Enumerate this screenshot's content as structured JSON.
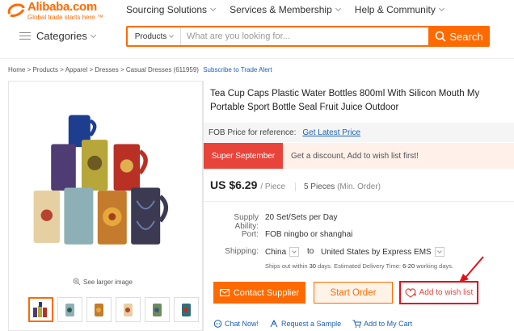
{
  "logo": {
    "brand": "Alibaba.com",
    "tagline": "Global trade starts here.™"
  },
  "topnav": [
    {
      "label": "Sourcing Solutions"
    },
    {
      "label": "Services & Membership"
    },
    {
      "label": "Help & Community"
    }
  ],
  "categories_label": "Categories",
  "search": {
    "category": "Products",
    "placeholder": "What are you looking for...",
    "button": "Search"
  },
  "breadcrumb": {
    "path": "Home > Products > Apparel > Dresses > Casual Dresses (611959)",
    "alert": "Subscribe to Trade Alert"
  },
  "gallery": {
    "see_larger": "See larger image"
  },
  "product": {
    "title": "Tea Cup Caps Plastic Water Bottles 800ml With Silicon Mouth My Portable Sport Bottle Seal Fruit Juice Outdoor",
    "fob_label": "FOB Price for reference:",
    "fob_link": "Get Latest Price",
    "promo_tag": "Super September",
    "promo_text": "Get a discount, Add to wish list first!",
    "price": "US $6.29",
    "price_unit": "/ Piece",
    "moq": "5 Pieces",
    "moq_note": "(Min. Order)"
  },
  "specs": {
    "supply_label": "Supply Ability:",
    "supply_value": "20 Set/Sets per Day",
    "port_label": "Port:",
    "port_value": "FOB ningbo or shanghai",
    "shipping_label": "Shipping:",
    "ship_from": "China",
    "ship_to_word": "to",
    "ship_to": "United States by Express EMS",
    "note_prefix": "Ships out within",
    "note_days": "30",
    "note_middle": "days. Estimated Delivery Time:",
    "note_range": "6-20",
    "note_suffix": "working days."
  },
  "actions": {
    "contact": "Contact Supplier",
    "start": "Start Order",
    "wish": "Add to wish list"
  },
  "links": {
    "chat": "Chat Now!",
    "sample": "Request a Sample",
    "cart": "Add to My Cart"
  },
  "colors": {
    "accent": "#ff6a00",
    "promo_red": "#e8443a",
    "link_blue": "#1a5fb4",
    "highlight_red": "#e0121c"
  }
}
